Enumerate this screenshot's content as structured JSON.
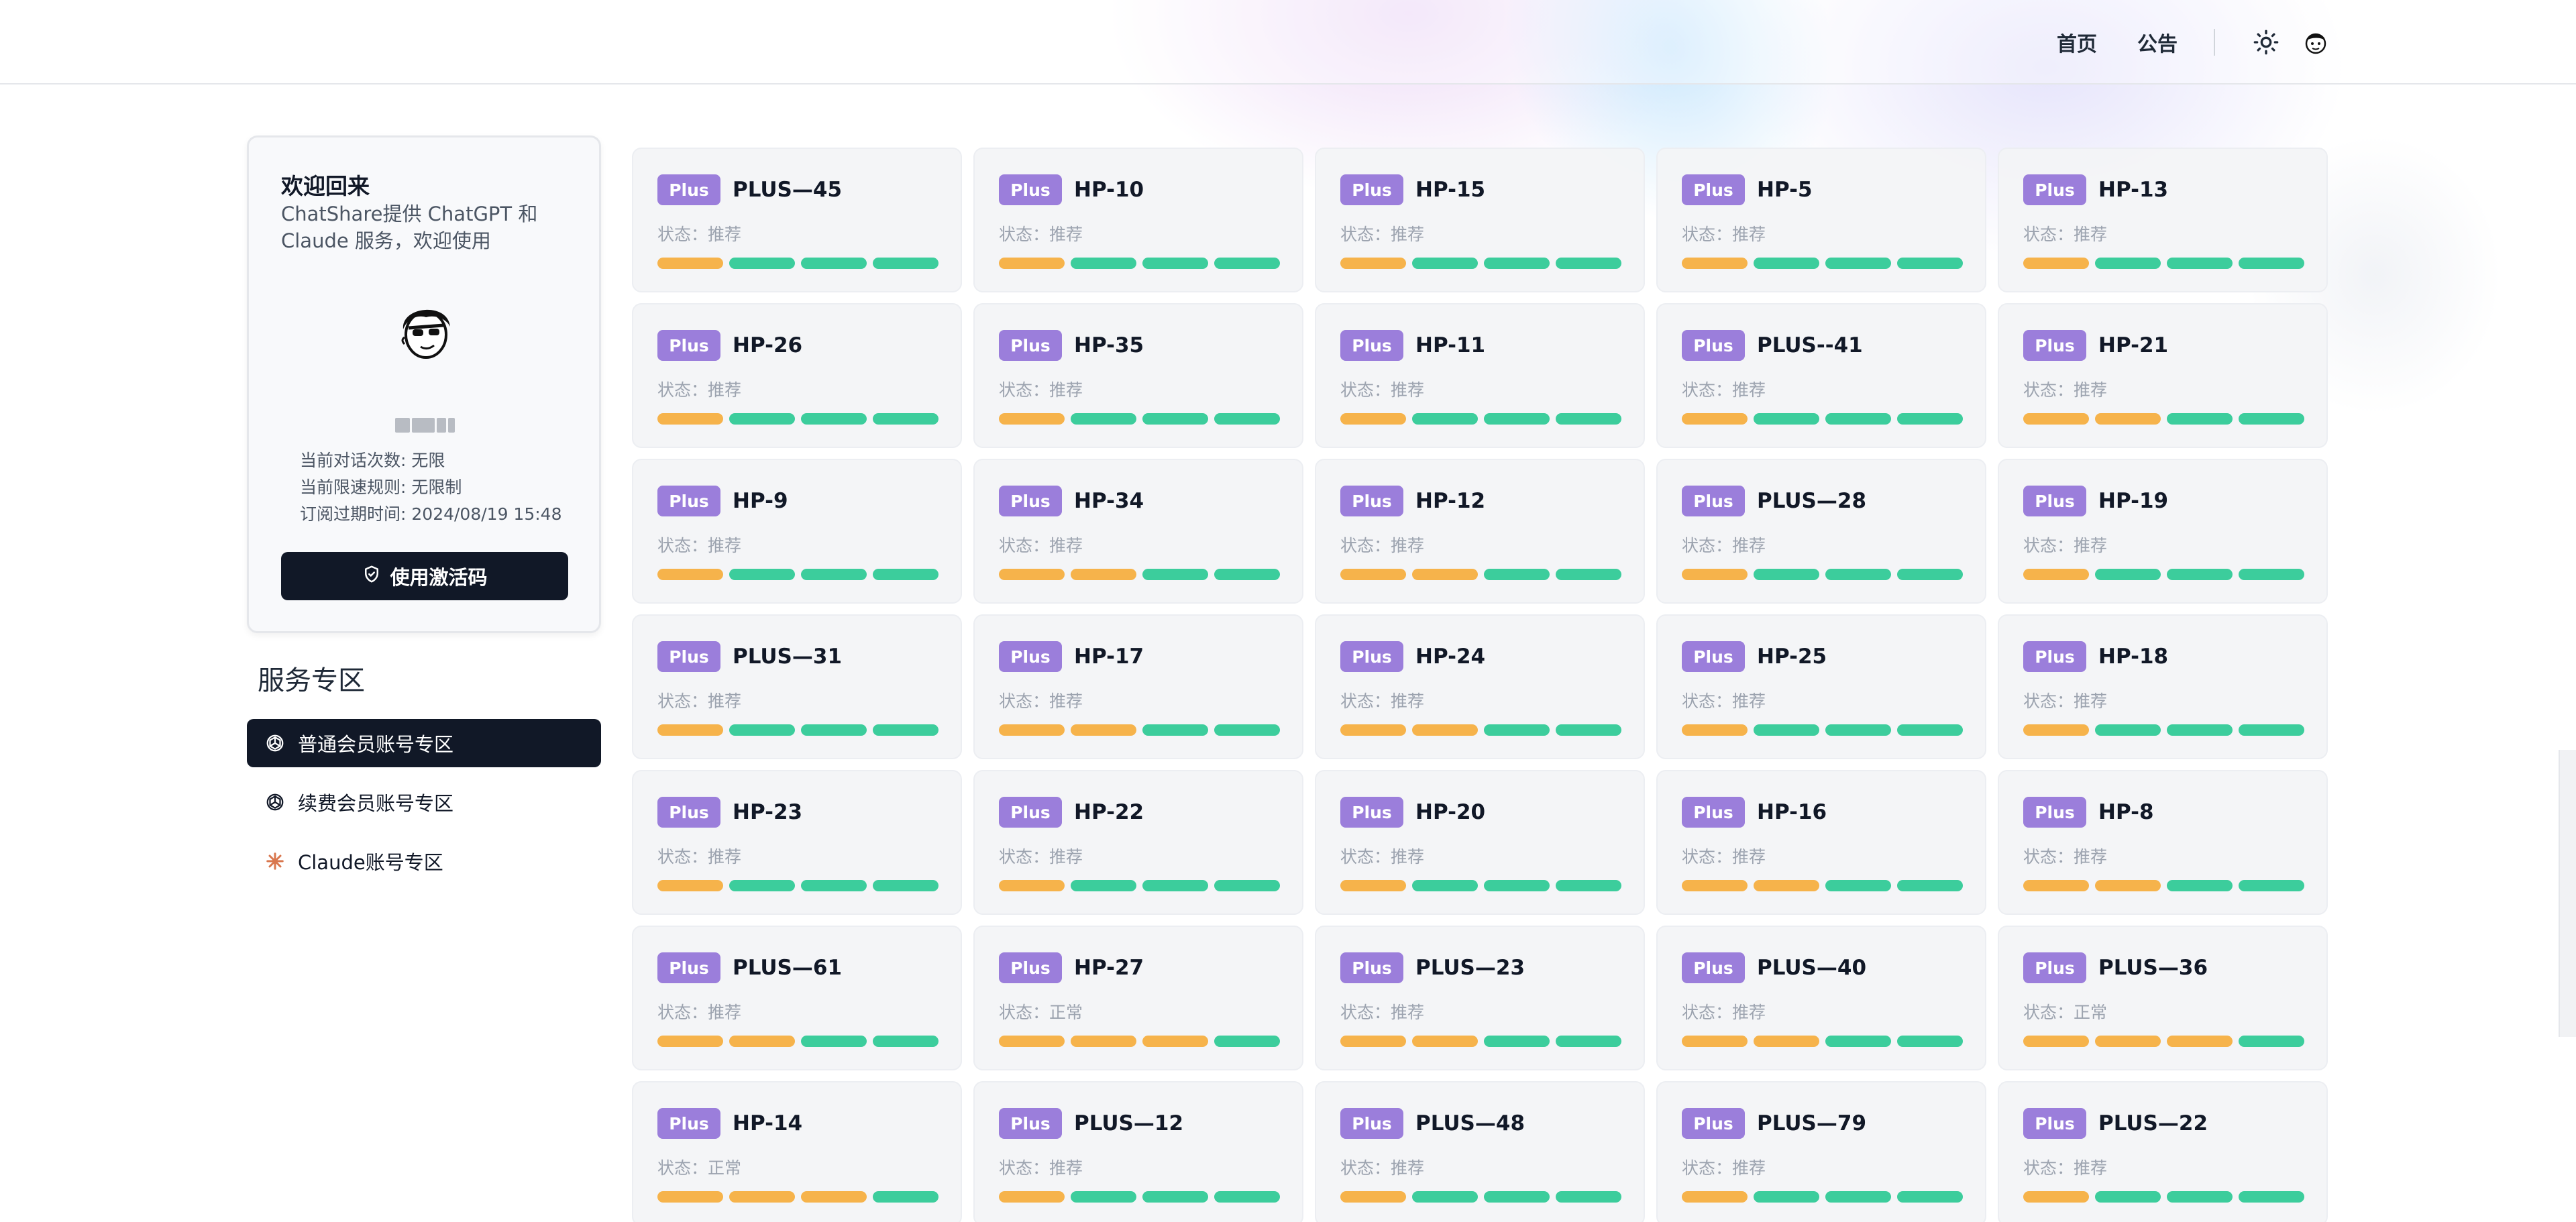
{
  "header": {
    "nav": [
      {
        "label": "首页"
      },
      {
        "label": "公告"
      }
    ],
    "theme_icon": "sun-icon",
    "avatar_icon": "cartoon-avatar-icon"
  },
  "profile": {
    "title": "欢迎回来",
    "description": "ChatShare提供 ChatGPT 和 Claude 服务，欢迎使用",
    "stats": [
      {
        "label": "当前对话次数:",
        "value": "无限"
      },
      {
        "label": "当前限速规则:",
        "value": "无限制"
      },
      {
        "label": "订阅过期时间:",
        "value": "2024/08/19 15:48"
      }
    ],
    "activate_button": "使用激活码",
    "activate_icon": "shield-check-icon"
  },
  "services": {
    "title": "服务专区",
    "items": [
      {
        "label": "普通会员账号专区",
        "icon": "openai-icon",
        "active": true
      },
      {
        "label": "续费会员账号专区",
        "icon": "openai-icon",
        "active": false
      },
      {
        "label": "Claude账号专区",
        "icon": "claude-icon",
        "active": false
      }
    ]
  },
  "colors": {
    "badge": "#9b7edb",
    "bar_orange": "#f6b34b",
    "bar_green": "#3ccd9c",
    "dark": "#111827"
  },
  "accounts": [
    {
      "badge": "Plus",
      "name": "PLUS—45",
      "status": "状态：推荐",
      "bars": [
        "o",
        "g",
        "g",
        "g"
      ]
    },
    {
      "badge": "Plus",
      "name": "HP-10",
      "status": "状态：推荐",
      "bars": [
        "o",
        "g",
        "g",
        "g"
      ]
    },
    {
      "badge": "Plus",
      "name": "HP-15",
      "status": "状态：推荐",
      "bars": [
        "o",
        "g",
        "g",
        "g"
      ]
    },
    {
      "badge": "Plus",
      "name": "HP-5",
      "status": "状态：推荐",
      "bars": [
        "o",
        "g",
        "g",
        "g"
      ]
    },
    {
      "badge": "Plus",
      "name": "HP-13",
      "status": "状态：推荐",
      "bars": [
        "o",
        "g",
        "g",
        "g"
      ]
    },
    {
      "badge": "Plus",
      "name": "HP-26",
      "status": "状态：推荐",
      "bars": [
        "o",
        "g",
        "g",
        "g"
      ]
    },
    {
      "badge": "Plus",
      "name": "HP-35",
      "status": "状态：推荐",
      "bars": [
        "o",
        "g",
        "g",
        "g"
      ]
    },
    {
      "badge": "Plus",
      "name": "HP-11",
      "status": "状态：推荐",
      "bars": [
        "o",
        "g",
        "g",
        "g"
      ]
    },
    {
      "badge": "Plus",
      "name": "PLUS--41",
      "status": "状态：推荐",
      "bars": [
        "o",
        "g",
        "g",
        "g"
      ]
    },
    {
      "badge": "Plus",
      "name": "HP-21",
      "status": "状态：推荐",
      "bars": [
        "o",
        "o",
        "g",
        "g"
      ]
    },
    {
      "badge": "Plus",
      "name": "HP-9",
      "status": "状态：推荐",
      "bars": [
        "o",
        "g",
        "g",
        "g"
      ]
    },
    {
      "badge": "Plus",
      "name": "HP-34",
      "status": "状态：推荐",
      "bars": [
        "o",
        "o",
        "g",
        "g"
      ]
    },
    {
      "badge": "Plus",
      "name": "HP-12",
      "status": "状态：推荐",
      "bars": [
        "o",
        "o",
        "g",
        "g"
      ]
    },
    {
      "badge": "Plus",
      "name": "PLUS—28",
      "status": "状态：推荐",
      "bars": [
        "o",
        "g",
        "g",
        "g"
      ]
    },
    {
      "badge": "Plus",
      "name": "HP-19",
      "status": "状态：推荐",
      "bars": [
        "o",
        "g",
        "g",
        "g"
      ]
    },
    {
      "badge": "Plus",
      "name": "PLUS—31",
      "status": "状态：推荐",
      "bars": [
        "o",
        "g",
        "g",
        "g"
      ]
    },
    {
      "badge": "Plus",
      "name": "HP-17",
      "status": "状态：推荐",
      "bars": [
        "o",
        "o",
        "g",
        "g"
      ]
    },
    {
      "badge": "Plus",
      "name": "HP-24",
      "status": "状态：推荐",
      "bars": [
        "o",
        "o",
        "g",
        "g"
      ]
    },
    {
      "badge": "Plus",
      "name": "HP-25",
      "status": "状态：推荐",
      "bars": [
        "o",
        "g",
        "g",
        "g"
      ]
    },
    {
      "badge": "Plus",
      "name": "HP-18",
      "status": "状态：推荐",
      "bars": [
        "o",
        "g",
        "g",
        "g"
      ]
    },
    {
      "badge": "Plus",
      "name": "HP-23",
      "status": "状态：推荐",
      "bars": [
        "o",
        "g",
        "g",
        "g"
      ]
    },
    {
      "badge": "Plus",
      "name": "HP-22",
      "status": "状态：推荐",
      "bars": [
        "o",
        "g",
        "g",
        "g"
      ]
    },
    {
      "badge": "Plus",
      "name": "HP-20",
      "status": "状态：推荐",
      "bars": [
        "o",
        "g",
        "g",
        "g"
      ]
    },
    {
      "badge": "Plus",
      "name": "HP-16",
      "status": "状态：推荐",
      "bars": [
        "o",
        "o",
        "g",
        "g"
      ]
    },
    {
      "badge": "Plus",
      "name": "HP-8",
      "status": "状态：推荐",
      "bars": [
        "o",
        "o",
        "g",
        "g"
      ]
    },
    {
      "badge": "Plus",
      "name": "PLUS—61",
      "status": "状态：推荐",
      "bars": [
        "o",
        "o",
        "g",
        "g"
      ]
    },
    {
      "badge": "Plus",
      "name": "HP-27",
      "status": "状态：正常",
      "bars": [
        "o",
        "o",
        "o",
        "g"
      ]
    },
    {
      "badge": "Plus",
      "name": "PLUS—23",
      "status": "状态：推荐",
      "bars": [
        "o",
        "o",
        "g",
        "g"
      ]
    },
    {
      "badge": "Plus",
      "name": "PLUS—40",
      "status": "状态：推荐",
      "bars": [
        "o",
        "o",
        "g",
        "g"
      ]
    },
    {
      "badge": "Plus",
      "name": "PLUS—36",
      "status": "状态：正常",
      "bars": [
        "o",
        "o",
        "o",
        "g"
      ]
    },
    {
      "badge": "Plus",
      "name": "HP-14",
      "status": "状态：正常",
      "bars": [
        "o",
        "o",
        "o",
        "g"
      ]
    },
    {
      "badge": "Plus",
      "name": "PLUS—12",
      "status": "状态：推荐",
      "bars": [
        "o",
        "g",
        "g",
        "g"
      ]
    },
    {
      "badge": "Plus",
      "name": "PLUS—48",
      "status": "状态：推荐",
      "bars": [
        "o",
        "g",
        "g",
        "g"
      ]
    },
    {
      "badge": "Plus",
      "name": "PLUS—79",
      "status": "状态：推荐",
      "bars": [
        "o",
        "g",
        "g",
        "g"
      ]
    },
    {
      "badge": "Plus",
      "name": "PLUS—22",
      "status": "状态：推荐",
      "bars": [
        "o",
        "g",
        "g",
        "g"
      ]
    }
  ]
}
